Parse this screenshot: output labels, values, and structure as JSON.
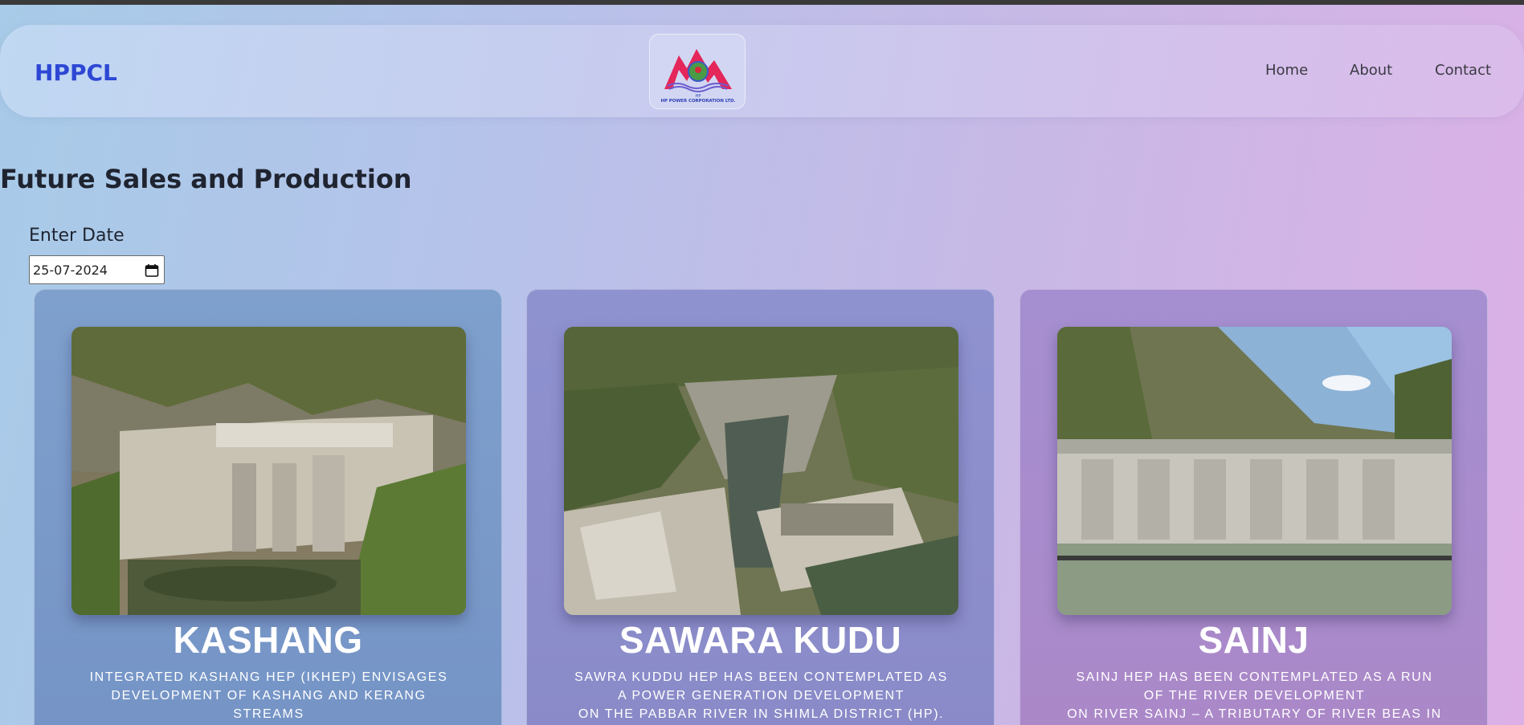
{
  "navbar": {
    "brand": "HPPCL",
    "logo_text": "HP POWER CORPORATION LTD.",
    "links": [
      "Home",
      "About",
      "Contact"
    ]
  },
  "page": {
    "title": "Future Sales and Production",
    "date_label": "Enter Date",
    "date_value": "25-07-2024"
  },
  "projects": [
    {
      "name": "KASHANG",
      "description_lines": [
        "INTEGRATED KASHANG HEP (IKHEP) ENVISAGES",
        "DEVELOPMENT OF KASHANG AND KERANG",
        "STREAMS"
      ]
    },
    {
      "name": "SAWARA KUDU",
      "description_lines": [
        "SAWRA KUDDU HEP HAS BEEN CONTEMPLATED AS",
        "A POWER GENERATION DEVELOPMENT",
        "ON THE PABBAR RIVER IN SHIMLA DISTRICT (HP)."
      ]
    },
    {
      "name": "SAINJ",
      "description_lines": [
        "SAINJ HEP HAS BEEN CONTEMPLATED AS A RUN",
        "OF THE RIVER DEVELOPMENT",
        "ON RIVER SAINJ – A TRIBUTARY OF RIVER BEAS IN"
      ]
    }
  ],
  "colors": {
    "brand": "#2d47d4",
    "logo_peaks": "#e4265a"
  }
}
